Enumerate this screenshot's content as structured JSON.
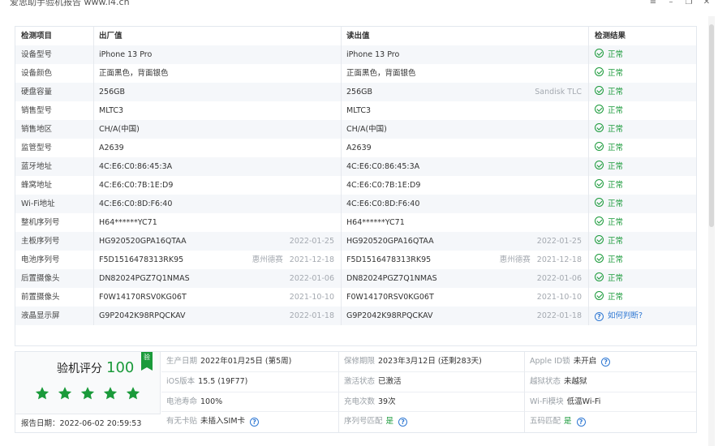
{
  "window": {
    "title": "爱思助手验机报告 www.i4.cn"
  },
  "table": {
    "headers": [
      "检测项目",
      "出厂值",
      "读出值",
      "检测结果"
    ],
    "rows": [
      {
        "item": "设备型号",
        "factory": "iPhone 13 Pro",
        "factory_note": "",
        "factory_date": "",
        "read": "iPhone 13 Pro",
        "read_note": "",
        "read_date": "",
        "result": "正常",
        "status": "ok"
      },
      {
        "item": "设备颜色",
        "factory": "正面黑色，背面银色",
        "factory_note": "",
        "factory_date": "",
        "read": "正面黑色，背面银色",
        "read_note": "",
        "read_date": "",
        "result": "正常",
        "status": "ok"
      },
      {
        "item": "硬盘容量",
        "factory": "256GB",
        "factory_note": "",
        "factory_date": "",
        "read": "256GB",
        "read_note": "",
        "read_date": "Sandisk TLC",
        "result": "正常",
        "status": "ok"
      },
      {
        "item": "销售型号",
        "factory": "MLTC3",
        "factory_note": "",
        "factory_date": "",
        "read": "MLTC3",
        "read_note": "",
        "read_date": "",
        "result": "正常",
        "status": "ok"
      },
      {
        "item": "销售地区",
        "factory": "CH/A(中国)",
        "factory_note": "",
        "factory_date": "",
        "read": "CH/A(中国)",
        "read_note": "",
        "read_date": "",
        "result": "正常",
        "status": "ok"
      },
      {
        "item": "监管型号",
        "factory": "A2639",
        "factory_note": "",
        "factory_date": "",
        "read": "A2639",
        "read_note": "",
        "read_date": "",
        "result": "正常",
        "status": "ok"
      },
      {
        "item": "蓝牙地址",
        "factory": "4C:E6:C0:86:45:3A",
        "factory_note": "",
        "factory_date": "",
        "read": "4C:E6:C0:86:45:3A",
        "read_note": "",
        "read_date": "",
        "result": "正常",
        "status": "ok"
      },
      {
        "item": "蜂窝地址",
        "factory": "4C:E6:C0:7B:1E:D9",
        "factory_note": "",
        "factory_date": "",
        "read": "4C:E6:C0:7B:1E:D9",
        "read_note": "",
        "read_date": "",
        "result": "正常",
        "status": "ok"
      },
      {
        "item": "Wi-Fi地址",
        "factory": "4C:E6:C0:8D:F6:40",
        "factory_note": "",
        "factory_date": "",
        "read": "4C:E6:C0:8D:F6:40",
        "read_note": "",
        "read_date": "",
        "result": "正常",
        "status": "ok"
      },
      {
        "item": "整机序列号",
        "factory": "H64******YC71",
        "factory_note": "",
        "factory_date": "",
        "read": "H64******YC71",
        "read_note": "",
        "read_date": "",
        "result": "正常",
        "status": "ok"
      },
      {
        "item": "主板序列号",
        "factory": "HG920520GPA16QTAA",
        "factory_note": "",
        "factory_date": "2022-01-25",
        "read": "HG920520GPA16QTAA",
        "read_note": "",
        "read_date": "2022-01-25",
        "result": "正常",
        "status": "ok"
      },
      {
        "item": "电池序列号",
        "factory": "F5D1516478313RK95",
        "factory_note": "惠州德赛",
        "factory_date": "2021-12-18",
        "read": "F5D1516478313RK95",
        "read_note": "惠州德赛",
        "read_date": "2021-12-18",
        "result": "正常",
        "status": "ok"
      },
      {
        "item": "后置摄像头",
        "factory": "DN82024PGZ7Q1NMAS",
        "factory_note": "",
        "factory_date": "2022-01-06",
        "read": "DN82024PGZ7Q1NMAS",
        "read_note": "",
        "read_date": "2022-01-06",
        "result": "正常",
        "status": "ok"
      },
      {
        "item": "前置摄像头",
        "factory": "F0W14170RSV0KG06T",
        "factory_note": "",
        "factory_date": "2021-10-10",
        "read": "F0W14170RSV0KG06T",
        "read_note": "",
        "read_date": "2021-10-10",
        "result": "正常",
        "status": "ok"
      },
      {
        "item": "液晶显示屏",
        "factory": "G9P2042K98RPQCKAV",
        "factory_note": "",
        "factory_date": "2022-01-18",
        "read": "G9P2042K98RPQCKAV",
        "read_note": "",
        "read_date": "2022-01-18",
        "result": "如何判断?",
        "status": "ask"
      }
    ]
  },
  "summary": {
    "score_label": "验机评分",
    "score": "100",
    "badge": "验",
    "stars": 5,
    "report_date": "报告日期：2022-06-02 20:59:53",
    "info": [
      {
        "key": "生产日期",
        "value": "2022年01月25日 (第5周)"
      },
      {
        "key": "保修期限",
        "value": "2023年3月12日 (还剩283天)"
      },
      {
        "key": "Apple ID锁",
        "value": "未开启"
      },
      {
        "key": "iOS版本",
        "value": "15.5 (19F77)"
      },
      {
        "key": "激活状态",
        "value": "已激活"
      },
      {
        "key": "越狱状态",
        "value": "未越狱"
      },
      {
        "key": "电池寿命",
        "value": "100%"
      },
      {
        "key": "充电次数",
        "value": "39次"
      },
      {
        "key": "Wi-Fi模块",
        "value": "低温Wi-Fi"
      },
      {
        "key": "有无卡贴",
        "value": "未插入SIM卡"
      },
      {
        "key": "序列号匹配",
        "value": "是"
      },
      {
        "key": "五码匹配",
        "value": "是"
      }
    ]
  },
  "colors": {
    "ok_green": "#1a9a3a",
    "link_blue": "#2f78d3"
  }
}
